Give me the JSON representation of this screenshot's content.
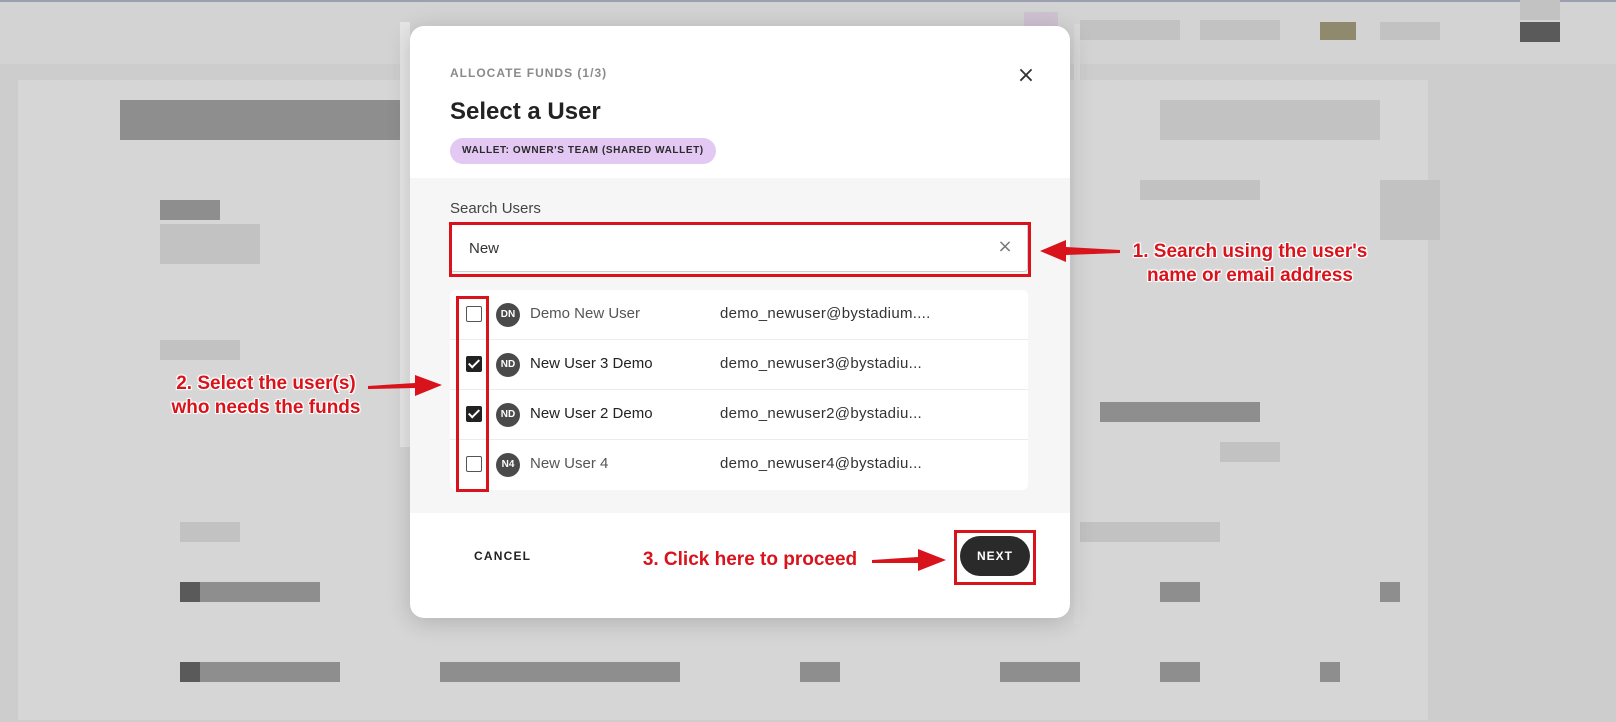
{
  "modal": {
    "step_label": "ALLOCATE FUNDS (1/3)",
    "title": "Select a User",
    "wallet_badge": "WALLET: OWNER'S TEAM (SHARED WALLET)",
    "search": {
      "label": "Search Users",
      "value": "New"
    },
    "users": [
      {
        "initials": "DN",
        "name": "Demo New User",
        "email": "demo_newuser@bystadium....",
        "checked": false
      },
      {
        "initials": "ND",
        "name": "New User 3 Demo",
        "email": "demo_newuser3@bystadiu...",
        "checked": true
      },
      {
        "initials": "ND",
        "name": "New User 2 Demo",
        "email": "demo_newuser2@bystadiu...",
        "checked": true
      },
      {
        "initials": "N4",
        "name": "New User 4",
        "email": "demo_newuser4@bystadiu...",
        "checked": false
      }
    ],
    "cancel_label": "CANCEL",
    "next_label": "NEXT"
  },
  "annotations": {
    "step1": "1. Search using the user's\nname or email address",
    "step2": "2. Select the user(s)\nwho needs the funds",
    "step3": "3. Click here to proceed"
  },
  "colors": {
    "annotation_red": "#d9131b",
    "badge_purple": "#e3c8f3",
    "button_dark": "#2a2a2a"
  }
}
